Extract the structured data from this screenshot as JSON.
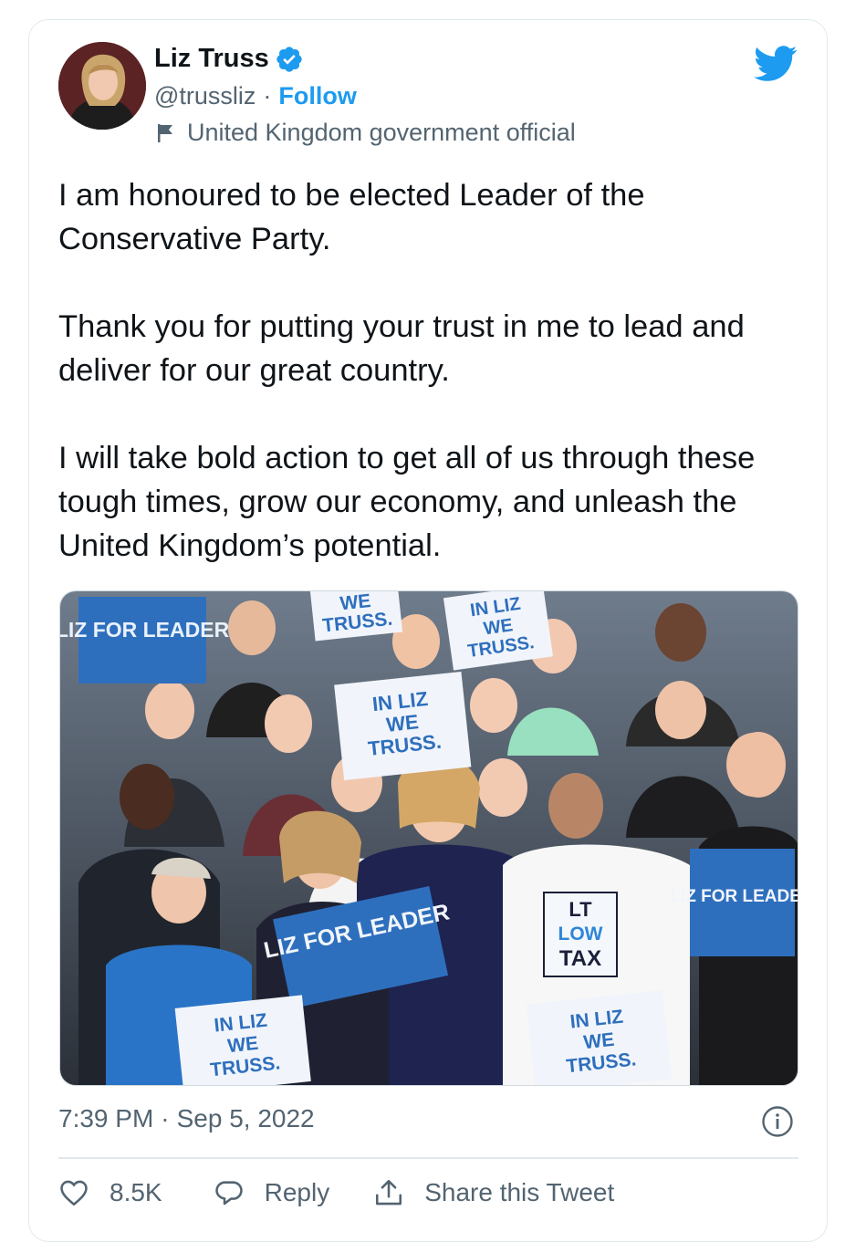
{
  "author": {
    "name": "Liz Truss",
    "handle": "@trussliz",
    "follow_label": "Follow",
    "label": "United Kingdom government official"
  },
  "tweet": {
    "paragraphs": [
      "I am honoured to be elected Leader of the Conservative Party.",
      "Thank you for putting your trust in me to lead and deliver for our great country.",
      "I will take bold action to get all of us through these tough times, grow our economy, and unleash the United Kingdom’s potential."
    ]
  },
  "media": {
    "signs": {
      "liz_for_leader": "LIZ FOR LEADER",
      "in_liz": "IN LIZ",
      "we": "WE",
      "truss": "TRUSS.",
      "lt": "LT",
      "low": "LOW",
      "tax": "TAX"
    }
  },
  "meta": {
    "time": "7:39 PM",
    "separator": "·",
    "date": "Sep 5, 2022"
  },
  "actions": {
    "like_count": "8.5K",
    "reply_label": "Reply",
    "share_label": "Share this Tweet"
  },
  "colors": {
    "accent": "#1d9bf0",
    "text": "#0f1419",
    "secondary": "#536471",
    "sign_blue": "#2e6fbd"
  }
}
